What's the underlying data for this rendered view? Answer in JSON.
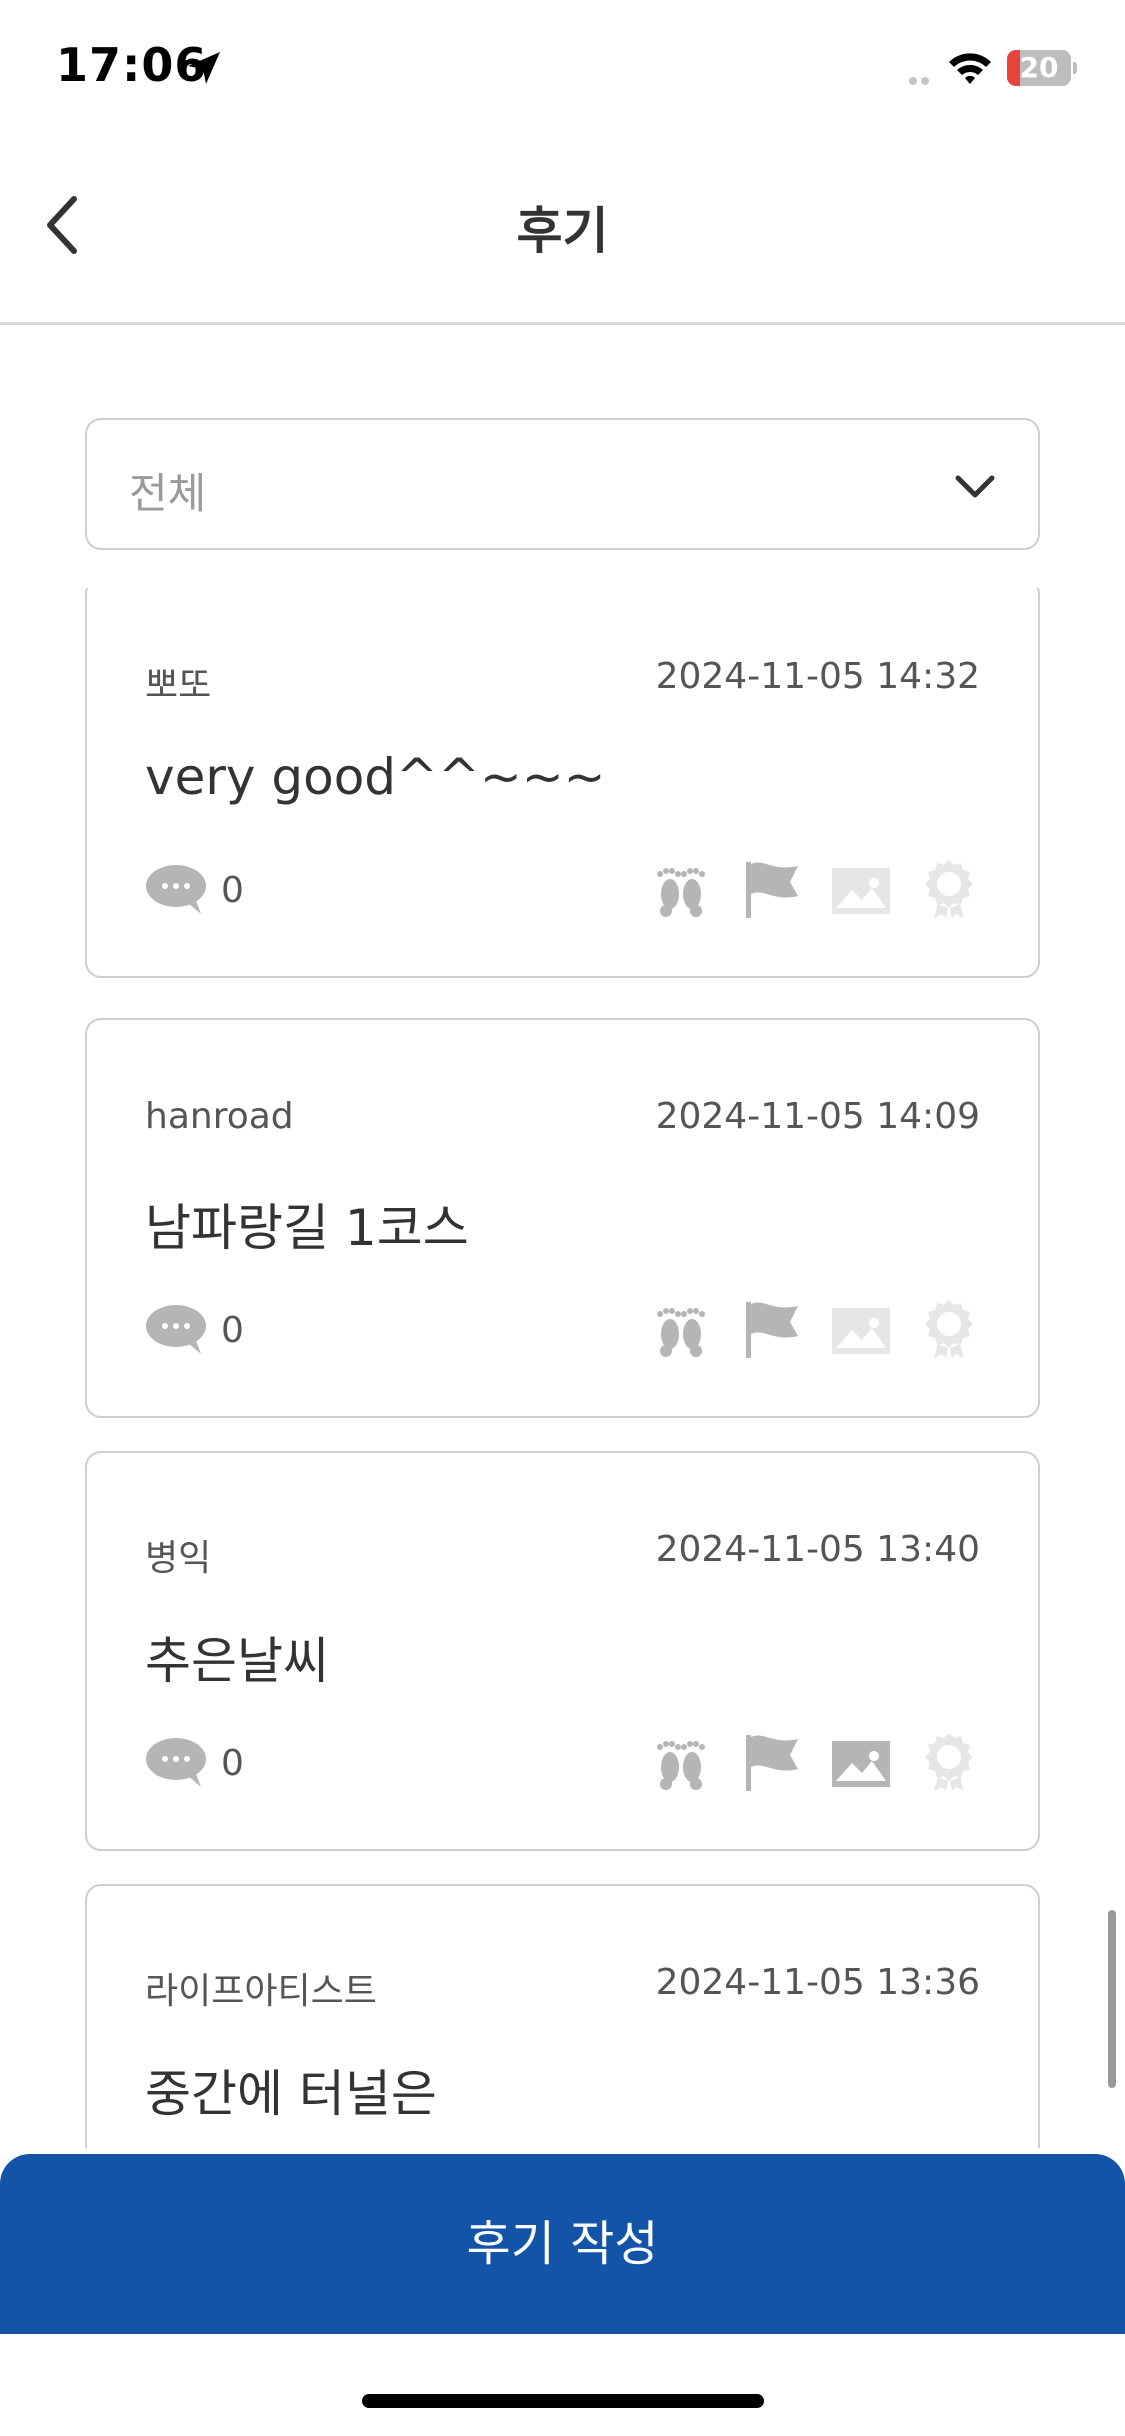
{
  "status_bar": {
    "time": "17:06",
    "battery_text": "20",
    "battery_level": 0.2
  },
  "nav": {
    "title": "후기",
    "back_icon": "chevron-left-icon"
  },
  "filter": {
    "selected": "전체",
    "icon": "chevron-down-icon"
  },
  "reviews": [
    {
      "author": "뽀또",
      "date": "2024-11-05 14:32",
      "title": "very good^^~~~",
      "comment_count": "0",
      "badges": {
        "footprint": true,
        "flag": true,
        "photo": false,
        "award": false
      }
    },
    {
      "author": "hanroad",
      "date": "2024-11-05 14:09",
      "title": "남파랑길 1코스",
      "comment_count": "0",
      "badges": {
        "footprint": true,
        "flag": true,
        "photo": false,
        "award": false
      }
    },
    {
      "author": "병익",
      "date": "2024-11-05 13:40",
      "title": "추은날씨",
      "comment_count": "0",
      "badges": {
        "footprint": true,
        "flag": true,
        "photo": true,
        "award": false
      }
    },
    {
      "author": "라이프아티스트",
      "date": "2024-11-05 13:36",
      "title": "중간에 터널은",
      "comment_count": "",
      "badges": {}
    }
  ],
  "write_button": {
    "label": "후기 작성"
  },
  "colors": {
    "primary": "#1254a8",
    "badge_active": "#b5b5b5",
    "badge_inactive": "#e6e6e6",
    "battery_low": "#e5453a"
  }
}
